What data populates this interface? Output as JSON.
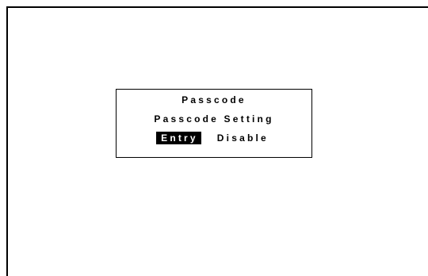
{
  "dialog": {
    "title": "Passcode",
    "subtitle": "Passcode Setting",
    "options": [
      {
        "label": "Entry",
        "selected": true
      },
      {
        "label": "Disable",
        "selected": false
      }
    ]
  },
  "colors": {
    "background": "#ffffff",
    "foreground": "#000000",
    "selected_bg": "#000000",
    "selected_fg": "#ffffff"
  }
}
